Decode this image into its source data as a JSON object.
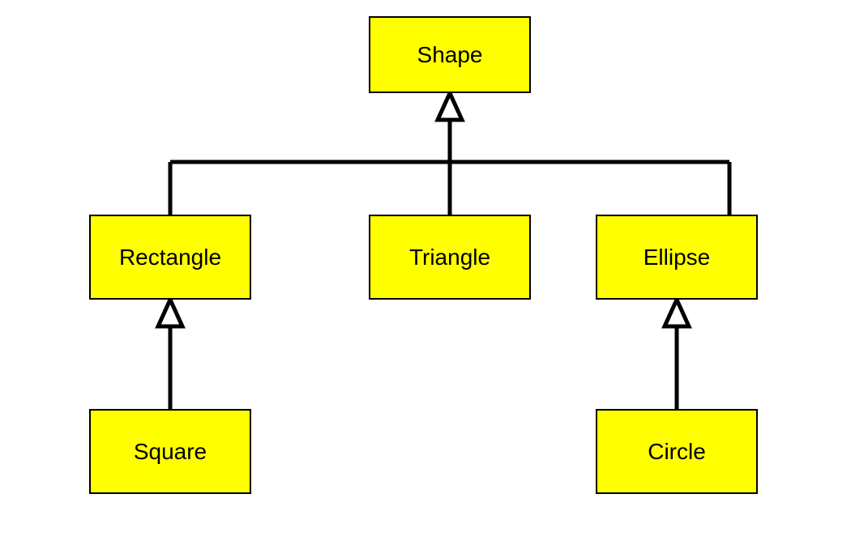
{
  "diagram": {
    "type": "uml-class-hierarchy",
    "colors": {
      "node_fill": "#ffff00",
      "node_border": "#000000",
      "line": "#000000"
    },
    "nodes": {
      "shape": {
        "label": "Shape"
      },
      "rectangle": {
        "label": "Rectangle"
      },
      "triangle": {
        "label": "Triangle"
      },
      "ellipse": {
        "label": "Ellipse"
      },
      "square": {
        "label": "Square"
      },
      "circle": {
        "label": "Circle"
      }
    },
    "edges": [
      {
        "from": "rectangle",
        "to": "shape",
        "kind": "generalization"
      },
      {
        "from": "triangle",
        "to": "shape",
        "kind": "generalization"
      },
      {
        "from": "ellipse",
        "to": "shape",
        "kind": "generalization"
      },
      {
        "from": "square",
        "to": "rectangle",
        "kind": "generalization"
      },
      {
        "from": "circle",
        "to": "ellipse",
        "kind": "generalization"
      }
    ]
  }
}
